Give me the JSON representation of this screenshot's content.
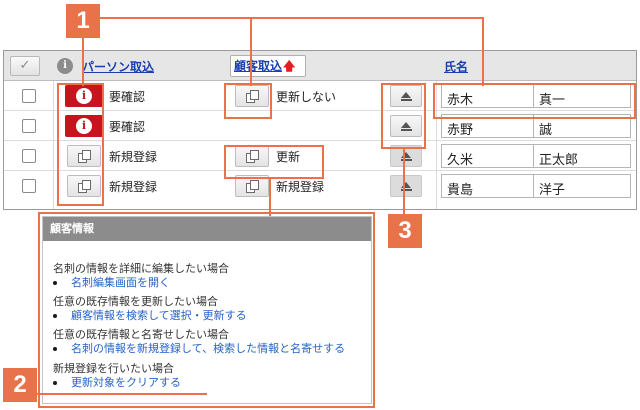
{
  "grid": {
    "header": {
      "check_icon": "✓",
      "info_icon": "i",
      "person_import_label": "パーソン取込",
      "customer_import_label": "顧客取込",
      "sort_arrow": "🡅",
      "name_label": "氏名"
    },
    "rows": [
      {
        "status": "要確認",
        "status_flag": "red-info",
        "customer_status": "更新しない",
        "last_name": "赤木",
        "first_name": "真一"
      },
      {
        "status": "要確認",
        "status_flag": "red-info",
        "customer_status": "",
        "last_name": "赤野",
        "first_name": "誠"
      },
      {
        "status": "新規登録",
        "status_flag": "copy",
        "customer_status": "更新",
        "last_name": "久米",
        "first_name": "正太郎"
      },
      {
        "status": "新規登録",
        "status_flag": "copy",
        "customer_status": "新規登録",
        "last_name": "貴島",
        "first_name": "洋子"
      }
    ]
  },
  "popup": {
    "title": "顧客情報",
    "sections": [
      {
        "desc": "名刺の情報を詳細に編集したい場合",
        "link": "名刺編集画面を開く"
      },
      {
        "desc": "任意の既存情報を更新したい場合",
        "link": "顧客情報を検索して選択・更新する"
      },
      {
        "desc": "任意の既存情報と名寄せしたい場合",
        "link": "名刺の情報を新規登録して、検索した情報と名寄せする"
      },
      {
        "desc": "新規登録を行いたい場合",
        "link": "更新対象をクリアする"
      }
    ]
  },
  "annotations": {
    "callout_1": "1",
    "callout_2": "2",
    "callout_3": "3",
    "accent_color": "#e8734a"
  },
  "colors": {
    "danger": "#c8141e",
    "link": "#2563c9",
    "header_link": "#1a3fb0"
  }
}
